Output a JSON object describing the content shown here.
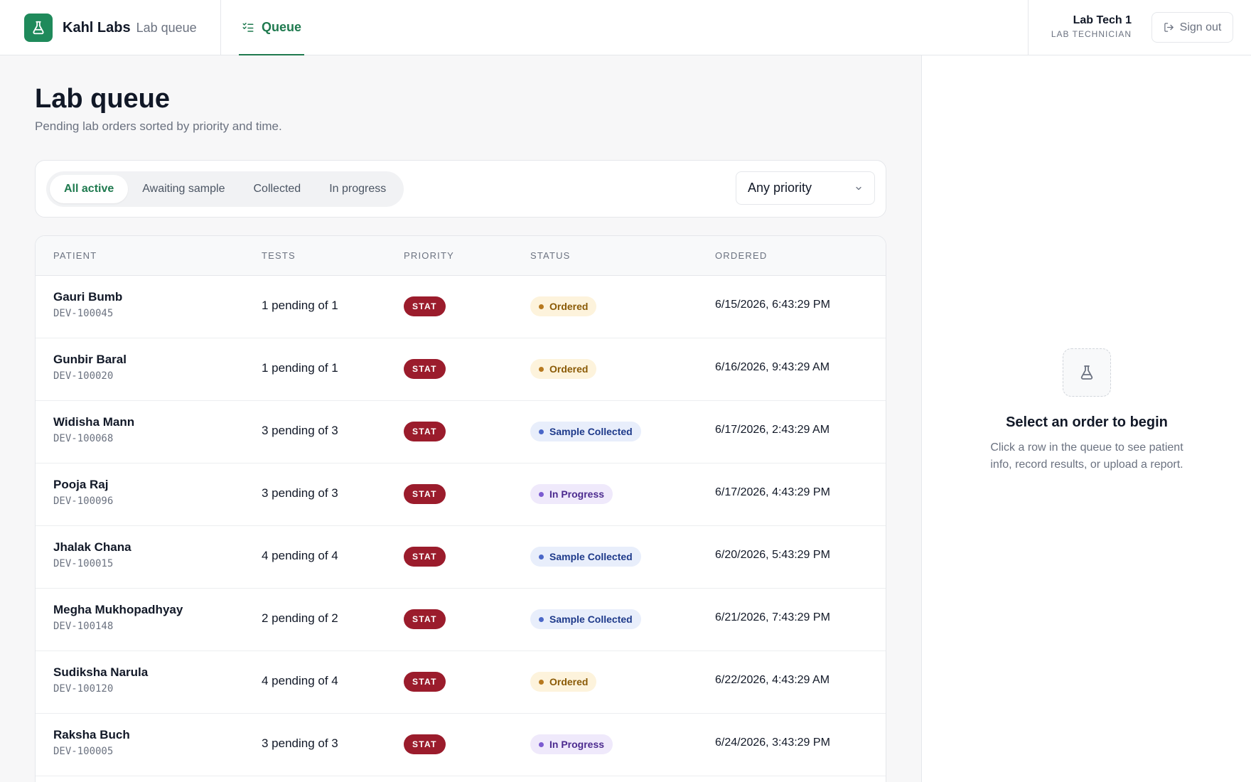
{
  "header": {
    "brand_name": "Kahl Labs",
    "brand_subtitle": "Lab queue",
    "nav_tab_label": "Queue",
    "user_name": "Lab Tech 1",
    "user_role": "LAB TECHNICIAN",
    "signout_label": "Sign out"
  },
  "page": {
    "title": "Lab queue",
    "subtitle": "Pending lab orders sorted by priority and time."
  },
  "filters": {
    "tabs": [
      "All active",
      "Awaiting sample",
      "Collected",
      "In progress"
    ],
    "active_tab": "All active",
    "priority_select": "Any priority"
  },
  "table": {
    "columns": [
      "Patient",
      "Tests",
      "Priority",
      "Status",
      "Ordered"
    ],
    "rows": [
      {
        "name": "Gauri Bumb",
        "id": "DEV-100045",
        "tests": "1 pending of 1",
        "priority": "STAT",
        "status": "Ordered",
        "ordered": "6/15/2026, 6:43:29 PM"
      },
      {
        "name": "Gunbir Baral",
        "id": "DEV-100020",
        "tests": "1 pending of 1",
        "priority": "STAT",
        "status": "Ordered",
        "ordered": "6/16/2026, 9:43:29 AM"
      },
      {
        "name": "Widisha Mann",
        "id": "DEV-100068",
        "tests": "3 pending of 3",
        "priority": "STAT",
        "status": "Sample Collected",
        "ordered": "6/17/2026, 2:43:29 AM"
      },
      {
        "name": "Pooja Raj",
        "id": "DEV-100096",
        "tests": "3 pending of 3",
        "priority": "STAT",
        "status": "In Progress",
        "ordered": "6/17/2026, 4:43:29 PM"
      },
      {
        "name": "Jhalak Chana",
        "id": "DEV-100015",
        "tests": "4 pending of 4",
        "priority": "STAT",
        "status": "Sample Collected",
        "ordered": "6/20/2026, 5:43:29 PM"
      },
      {
        "name": "Megha Mukhopadhyay",
        "id": "DEV-100148",
        "tests": "2 pending of 2",
        "priority": "STAT",
        "status": "Sample Collected",
        "ordered": "6/21/2026, 7:43:29 PM"
      },
      {
        "name": "Sudiksha Narula",
        "id": "DEV-100120",
        "tests": "4 pending of 4",
        "priority": "STAT",
        "status": "Ordered",
        "ordered": "6/22/2026, 4:43:29 AM"
      },
      {
        "name": "Raksha Buch",
        "id": "DEV-100005",
        "tests": "3 pending of 3",
        "priority": "STAT",
        "status": "In Progress",
        "ordered": "6/24/2026, 3:43:29 PM"
      }
    ]
  },
  "side_panel": {
    "icon": "flask-icon",
    "title": "Select an order to begin",
    "body": "Click a row in the queue to see patient info, record results, or upload a report."
  },
  "colors": {
    "brand": "#1f8a5b",
    "accent": "#1f7a4f",
    "stat": "#9b1c2c",
    "ordered_bg": "#fdf3dc",
    "collected_bg": "#e8eefb",
    "progress_bg": "#efe9fb"
  }
}
